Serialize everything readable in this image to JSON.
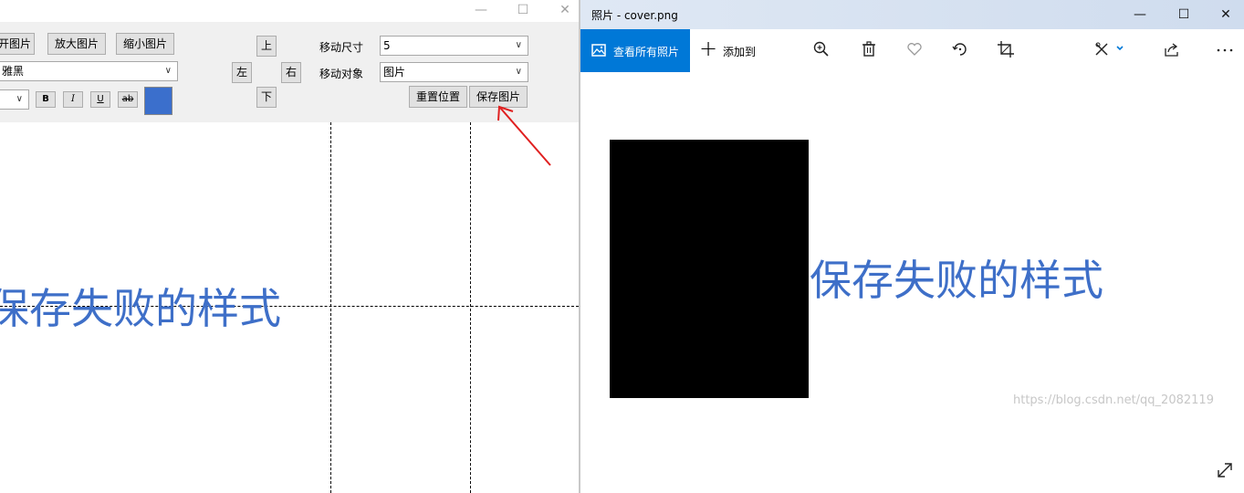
{
  "left_window": {
    "toolbar": {
      "open_label": "开图片",
      "zoom_in_label": "放大图片",
      "zoom_out_label": "缩小图片",
      "font_value": "雅黑",
      "bold_label": "B",
      "italic_label": "I",
      "underline_label": "U",
      "strike_label": "ab",
      "color_swatch": "#3b6fcc",
      "up_label": "上",
      "left_label": "左",
      "right_label": "右",
      "down_label": "下",
      "move_size_label": "移动尺寸",
      "move_size_value": "5",
      "move_target_label": "移动对象",
      "move_target_value": "图片",
      "reset_label": "重置位置",
      "save_label": "保存图片"
    },
    "canvas_text": "保存失败的样式",
    "text_color": "#3e6fc8"
  },
  "photos_window": {
    "title": "照片 - cover.png",
    "view_all_label": "查看所有照片",
    "add_to_label": "添加到",
    "content_text": "保存失败的样式",
    "accent_color": "#0078d7",
    "watermark": "https://blog.csdn.net/qq_2082119",
    "icons": [
      "zoom-icon",
      "delete-icon",
      "favorite-icon",
      "rotate-icon",
      "crop-icon",
      "edit-icon",
      "share-icon",
      "more-icon"
    ]
  }
}
